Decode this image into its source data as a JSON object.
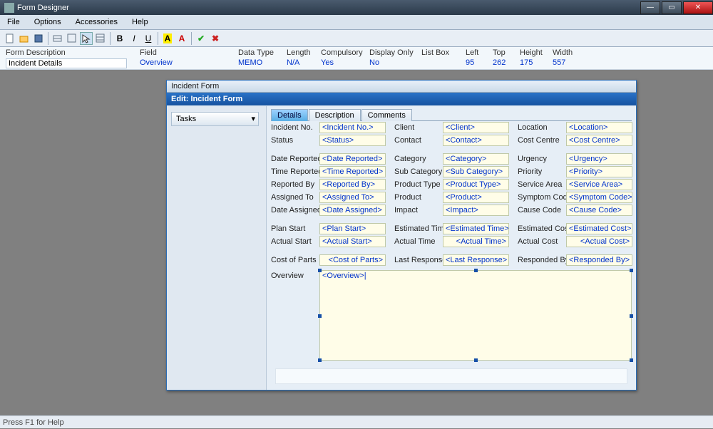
{
  "title": "Form Designer",
  "menu": [
    "File",
    "Options",
    "Accessories",
    "Help"
  ],
  "info": {
    "form_desc_hdr": "Form Description",
    "form_desc_val": "Incident Details",
    "field_hdr": "Field",
    "field_val": "Overview",
    "datatype_hdr": "Data Type",
    "datatype_val": "MEMO",
    "length_hdr": "Length",
    "length_val": "N/A",
    "compulsory_hdr": "Compulsory",
    "compulsory_val": "Yes",
    "display_hdr": "Display Only",
    "display_val": "No",
    "listbox_hdr": "List Box",
    "listbox_val": "",
    "left_hdr": "Left",
    "left_val": "95",
    "top_hdr": "Top",
    "top_val": "262",
    "height_hdr": "Height",
    "height_val": "175",
    "width_hdr": "Width",
    "width_val": "557"
  },
  "formwin": {
    "title_small": "Incident Form",
    "title_big": "Edit: Incident Form",
    "tasks": "Tasks",
    "tabs": [
      "Details",
      "Description",
      "Comments"
    ]
  },
  "fields": {
    "incident_no_l": "Incident No.",
    "incident_no_v": "<Incident No.>",
    "status_l": "Status",
    "status_v": "<Status>",
    "client_l": "Client",
    "client_v": "<Client>",
    "contact_l": "Contact",
    "contact_v": "<Contact>",
    "location_l": "Location",
    "location_v": "<Location>",
    "costcentre_l": "Cost Centre",
    "costcentre_v": "<Cost Centre>",
    "datereported_l": "Date Reported",
    "datereported_v": "<Date Reported>",
    "timereported_l": "Time Reported",
    "timereported_v": "<Time Reported>",
    "reportedby_l": "Reported By",
    "reportedby_v": "<Reported By>",
    "assignedto_l": "Assigned To",
    "assignedto_v": "<Assigned To>",
    "dateassigned_l": "Date Assigned",
    "dateassigned_v": "<Date Assigned>",
    "category_l": "Category",
    "category_v": "<Category>",
    "subcategory_l": "Sub Category",
    "subcategory_v": "<Sub Category>",
    "producttype_l": "Product Type",
    "producttype_v": "<Product Type>",
    "product_l": "Product",
    "product_v": "<Product>",
    "impact_l": "Impact",
    "impact_v": "<Impact>",
    "urgency_l": "Urgency",
    "urgency_v": "<Urgency>",
    "priority_l": "Priority",
    "priority_v": "<Priority>",
    "servicearea_l": "Service Area",
    "servicearea_v": "<Service Area>",
    "symptomcode_l": "Symptom Code",
    "symptomcode_v": "<Symptom Code>",
    "causecode_l": "Cause Code",
    "causecode_v": "<Cause Code>",
    "planstart_l": "Plan Start",
    "planstart_v": "<Plan Start>",
    "actualstart_l": "Actual Start",
    "actualstart_v": "<Actual Start>",
    "esttime_l": "Estimated Time",
    "esttime_v": "<Estimated Time>",
    "acttime_l": "Actual Time",
    "acttime_v": "<Actual Time>",
    "estcost_l": "Estimated Cost",
    "estcost_v": "<Estimated Cost>",
    "actcost_l": "Actual Cost",
    "actcost_v": "<Actual Cost>",
    "costparts_l": "Cost of Parts",
    "costparts_v": "<Cost of Parts>",
    "lastresp_l": "Last Response",
    "lastresp_v": "<Last Response>",
    "respby_l": "Responded By",
    "respby_v": "<Responded By>",
    "overview_l": "Overview",
    "overview_v": "<Overview>|"
  },
  "status": "Press F1 for Help"
}
